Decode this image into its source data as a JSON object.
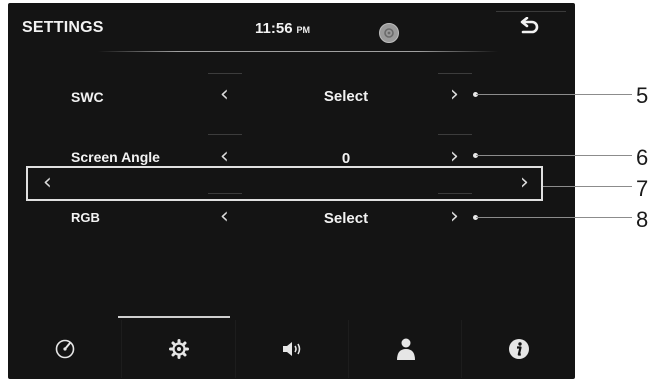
{
  "header": {
    "title": "SETTINGS",
    "time": "11:56",
    "ampm": "PM"
  },
  "rows": [
    {
      "label": "SWC",
      "value": "Select"
    },
    {
      "label": "Screen Angle",
      "value": "0"
    },
    {
      "label": "",
      "value": ""
    },
    {
      "label": "RGB",
      "value": "Select"
    }
  ],
  "callouts": [
    "5",
    "6",
    "7",
    "8"
  ],
  "tabs": [
    {
      "name": "tab-speed",
      "icon": "speedometer-icon"
    },
    {
      "name": "tab-settings",
      "icon": "gear-icon",
      "active": true
    },
    {
      "name": "tab-audio",
      "icon": "speaker-icon"
    },
    {
      "name": "tab-user",
      "icon": "person-icon"
    },
    {
      "name": "tab-info",
      "icon": "info-icon"
    }
  ],
  "colors": {
    "screen_bg": "#141414",
    "text": "#f2f2f2",
    "chevron": "#dcdcdc",
    "highlight_border": "#e0e0e0"
  }
}
